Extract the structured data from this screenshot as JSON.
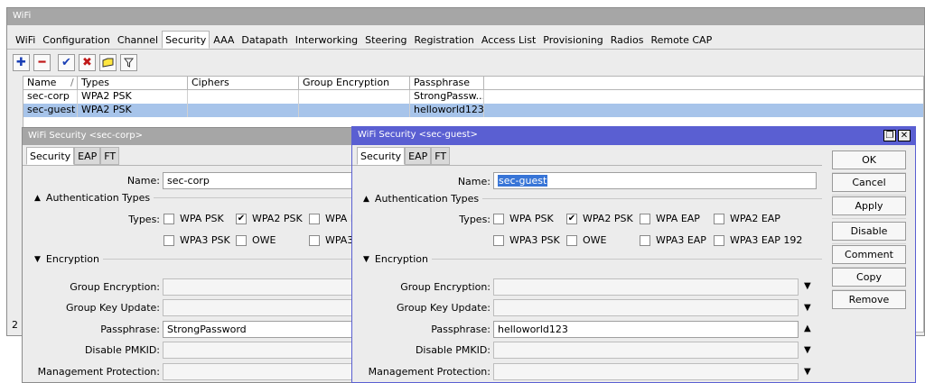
{
  "main": {
    "title": "WiFi",
    "tabs": [
      "WiFi",
      "Configuration",
      "Channel",
      "Security",
      "AAA",
      "Datapath",
      "Interworking",
      "Steering",
      "Registration",
      "Access List",
      "Provisioning",
      "Radios",
      "Remote CAP"
    ],
    "active_tab": "Security",
    "toolbar": [
      "add-icon",
      "remove-icon",
      "enable-icon",
      "disable-icon",
      "comment-icon",
      "filter-icon"
    ],
    "columns": [
      "Name",
      "/",
      "Types",
      "Ciphers",
      "Group Encryption",
      "Passphrase"
    ],
    "rows": [
      {
        "name": "sec-corp",
        "types": "WPA2 PSK",
        "ciphers": "",
        "group": "",
        "pass": "StrongPassw..."
      },
      {
        "name": "sec-guest",
        "types": "WPA2 PSK",
        "ciphers": "",
        "group": "",
        "pass": "helloworld123"
      }
    ],
    "status_count": "2"
  },
  "dlg1": {
    "title": "WiFi Security <sec-corp>",
    "tabs": [
      "Security",
      "EAP",
      "FT"
    ],
    "name_label": "Name:",
    "name_value": "sec-corp",
    "auth_section": "Authentication Types",
    "types_label": "Types:",
    "types": [
      {
        "label": "WPA PSK",
        "checked": false
      },
      {
        "label": "WPA2 PSK",
        "checked": true
      },
      {
        "label": "WPA E",
        "checked": false
      },
      {
        "label": "WPA3 PSK",
        "checked": false
      },
      {
        "label": "OWE",
        "checked": false
      },
      {
        "label": "WPA3",
        "checked": false
      }
    ],
    "enc_section": "Encryption",
    "group_enc": "Group Encryption:",
    "group_key": "Group Key Update:",
    "passphrase_label": "Passphrase:",
    "passphrase_value": "StrongPassword",
    "pmkid": "Disable PMKID:",
    "mgmt": "Management Protection:"
  },
  "dlg2": {
    "title": "WiFi Security <sec-guest>",
    "tabs": [
      "Security",
      "EAP",
      "FT"
    ],
    "name_label": "Name:",
    "name_value": "sec-guest",
    "auth_section": "Authentication Types",
    "types_label": "Types:",
    "types": [
      {
        "label": "WPA PSK",
        "checked": false
      },
      {
        "label": "WPA2 PSK",
        "checked": true
      },
      {
        "label": "WPA EAP",
        "checked": false
      },
      {
        "label": "WPA2 EAP",
        "checked": false
      },
      {
        "label": "WPA3 PSK",
        "checked": false
      },
      {
        "label": "OWE",
        "checked": false
      },
      {
        "label": "WPA3 EAP",
        "checked": false
      },
      {
        "label": "WPA3 EAP 192",
        "checked": false
      }
    ],
    "enc_section": "Encryption",
    "group_enc": "Group Encryption:",
    "group_key": "Group Key Update:",
    "passphrase_label": "Passphrase:",
    "passphrase_value": "helloworld123",
    "pmkid": "Disable PMKID:",
    "mgmt": "Management Protection:",
    "buttons": [
      "OK",
      "Cancel",
      "Apply",
      "Disable",
      "Comment",
      "Copy",
      "Remove"
    ]
  }
}
